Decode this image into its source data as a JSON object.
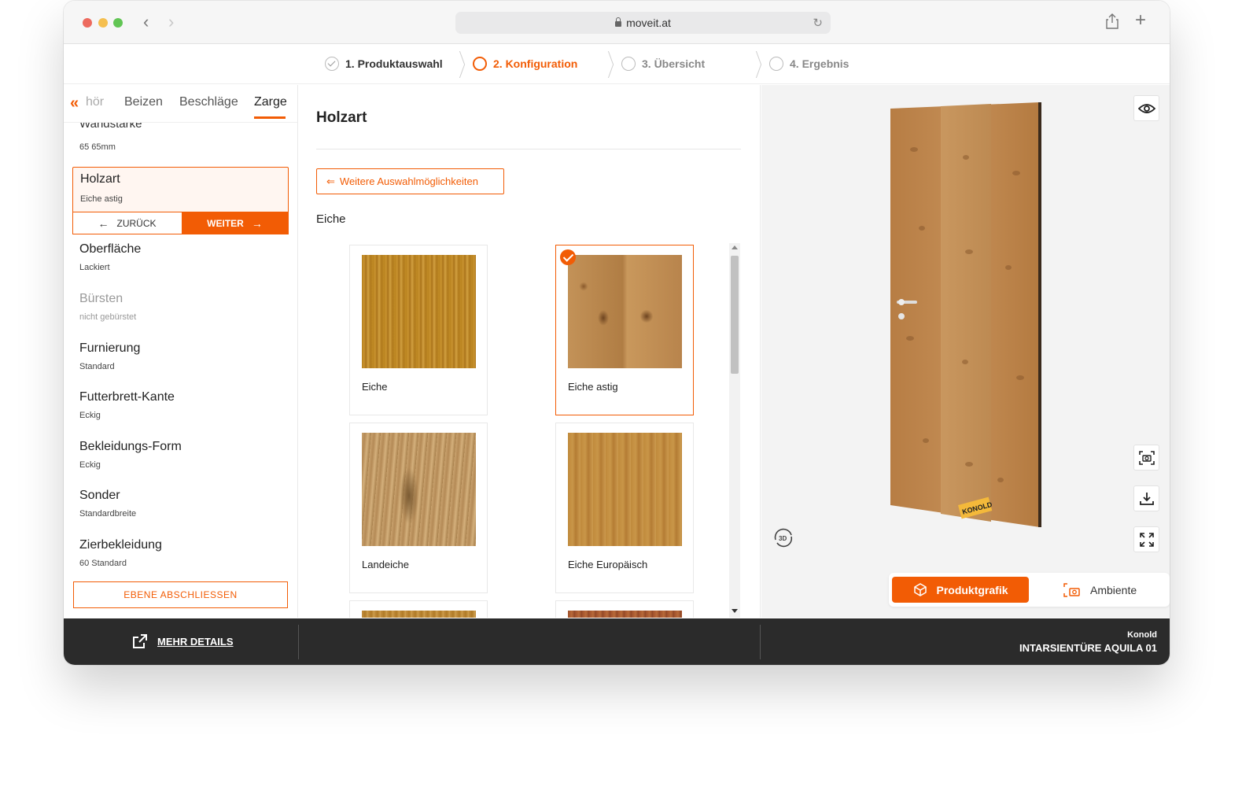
{
  "browser": {
    "url": "moveit.at"
  },
  "stepper": {
    "steps": [
      {
        "label": "1. Produktauswahl",
        "state": "done"
      },
      {
        "label": "2. Konfiguration",
        "state": "active"
      },
      {
        "label": "3. Übersicht",
        "state": "todo"
      },
      {
        "label": "4. Ergebnis",
        "state": "todo"
      }
    ]
  },
  "sidebar": {
    "tabs": [
      "hör",
      "Beizen",
      "Beschläge",
      "Zarge"
    ],
    "active_tab": "Zarge",
    "cut_item": {
      "title": "Wandstärke",
      "value": "65 65mm"
    },
    "selected": {
      "title": "Holzart",
      "value": "Eiche astig"
    },
    "back_label": "ZURÜCK",
    "next_label": "WEITER",
    "options": [
      {
        "title": "Oberfläche",
        "value": "Lackiert",
        "disabled": false
      },
      {
        "title": "Bürsten",
        "value": "nicht gebürstet",
        "disabled": true
      },
      {
        "title": "Furnierung",
        "value": "Standard",
        "disabled": false
      },
      {
        "title": "Futterbrett-Kante",
        "value": "Eckig",
        "disabled": false
      },
      {
        "title": "Bekleidungs-Form",
        "value": "Eckig",
        "disabled": false
      },
      {
        "title": "Sonder",
        "value": "Standardbreite",
        "disabled": false
      },
      {
        "title": "Zierbekleidung",
        "value": "60 Standard",
        "disabled": false
      }
    ],
    "finish_label": "EBENE ABSCHLIESSEN"
  },
  "center": {
    "title": "Holzart",
    "more_options_label": "Weitere Auswahlmöglichkeiten",
    "group_label": "Eiche",
    "woods": [
      {
        "name": "Eiche",
        "selected": false
      },
      {
        "name": "Eiche astig",
        "selected": true
      },
      {
        "name": "Landeiche",
        "selected": false
      },
      {
        "name": "Eiche Europäisch",
        "selected": false
      }
    ]
  },
  "preview": {
    "toggle_active": "Produktgrafik",
    "toggle_inactive": "Ambiente",
    "rotate_label": "3D",
    "door_badge": "KONOLD"
  },
  "footer": {
    "more_details": "MEHR DETAILS",
    "brand": "Konold",
    "product": "INTARSIENTÜRE AQUILA 01"
  },
  "colors": {
    "accent": "#f25c05",
    "footer_bg": "#2b2b2b"
  }
}
